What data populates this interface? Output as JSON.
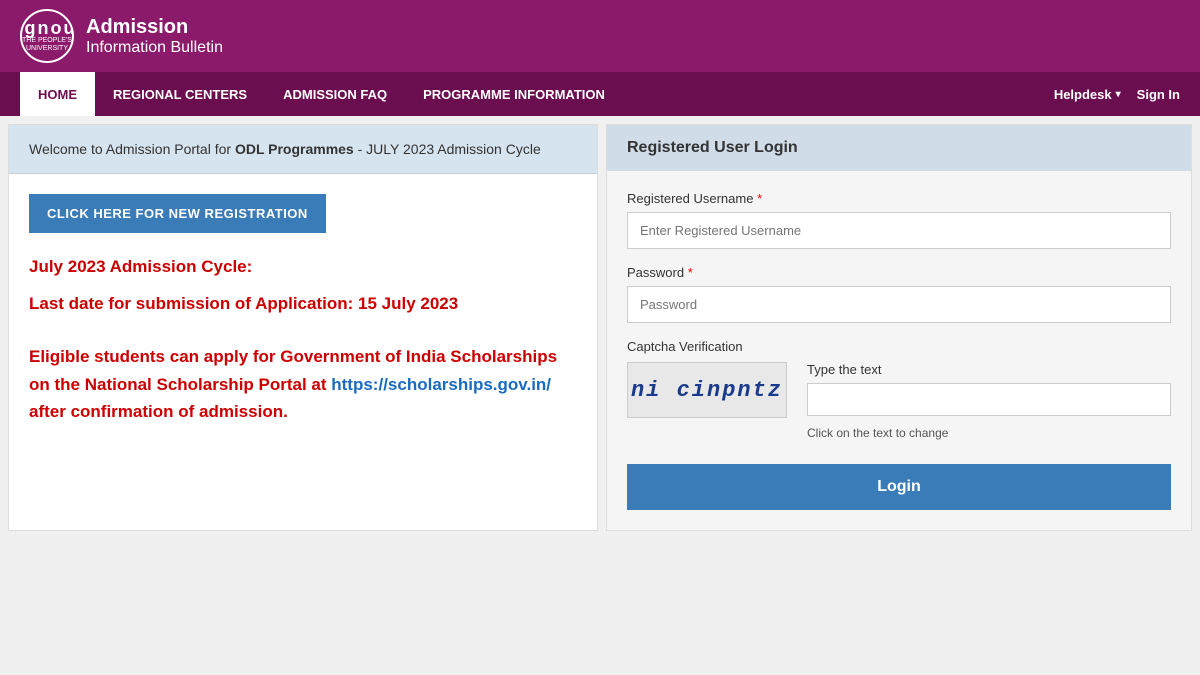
{
  "header": {
    "logo_text": "ignou",
    "logo_sub1": "THE PEOPLE'S",
    "logo_sub2": "UNIVERSITY",
    "title_line1": "Admission",
    "title_line2": "Information Bulletin"
  },
  "nav": {
    "items": [
      {
        "label": "HOME",
        "active": true
      },
      {
        "label": "REGIONAL CENTERS",
        "active": false
      },
      {
        "label": "ADMISSION FAQ",
        "active": false
      },
      {
        "label": "PROGRAMME INFORMATION",
        "active": false
      }
    ],
    "right_items": [
      {
        "label": "Helpdesk",
        "has_dropdown": true
      },
      {
        "label": "Sign In",
        "has_dropdown": false
      }
    ]
  },
  "left": {
    "welcome_text_prefix": "Welcome to Admission Portal for ",
    "welcome_bold": "ODL Programmes",
    "welcome_text_suffix": " - JULY 2023 Admission Cycle",
    "new_reg_button": "CLICK HERE FOR NEW REGISTRATION",
    "info_lines": [
      "July 2023 Admission Cycle:",
      "",
      "Last date for submission of Application: 15 July 2023",
      "",
      "Eligible students can apply for Government of India Scholarships on the National Scholarship Portal at https://scholarships.gov.in/ after confirmation of admission."
    ],
    "scholarship_link": "https://scholarships.gov.in/"
  },
  "login": {
    "title": "Registered User Login",
    "username_label": "Registered Username",
    "username_placeholder": "Enter Registered Username",
    "password_label": "Password",
    "password_placeholder": "Password",
    "captcha_label": "Captcha Verification",
    "captcha_text": "ni cinpntz",
    "captcha_type_label": "Type the text",
    "captcha_hint": "Click on the text to change",
    "captcha_input_placeholder": "",
    "login_button": "Login"
  }
}
